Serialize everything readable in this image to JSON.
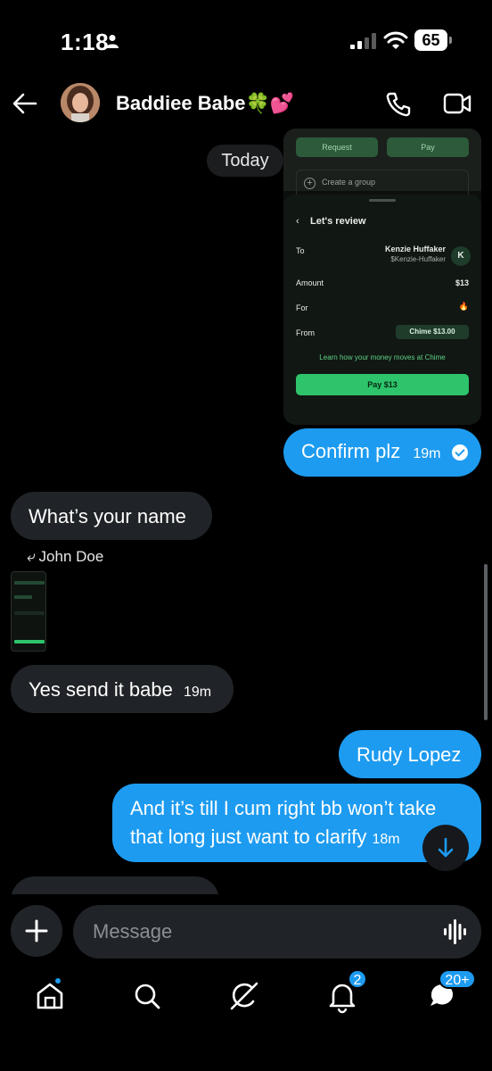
{
  "status_bar": {
    "time": "1:18",
    "battery": "65"
  },
  "header": {
    "contact_name": "Baddiee Babe🍀💕"
  },
  "conversation": {
    "date_separator": "Today",
    "embedded_screenshot": {
      "request_label": "Request",
      "pay_label": "Pay",
      "create_group": "Create a group",
      "title": "Let's review",
      "to_label": "To",
      "recipient_name": "Kenzie Huffaker",
      "recipient_tag": "$Kenzie-Huffaker",
      "recipient_initial": "K",
      "amount_label": "Amount",
      "amount_value": "$13",
      "for_label": "For",
      "for_value": "🔥",
      "from_label": "From",
      "from_value": "Chime  $13.00",
      "learn_link": "Learn how your money moves at Chime",
      "pay_button": "Pay $13"
    },
    "messages": [
      {
        "text": "Confirm plz",
        "time": "19m"
      },
      {
        "text": "What’s your name"
      },
      {
        "reply_to": "John Doe"
      },
      {
        "text": "Yes send it babe",
        "time": "19m"
      },
      {
        "text": "Rudy Lopez"
      },
      {
        "text": "And it’s till I cum right bb won’t take that long just want to clarify",
        "time": "18m"
      }
    ]
  },
  "composer": {
    "placeholder": "Message"
  },
  "tab_bar": {
    "notifications_badge": "2",
    "messages_badge": "20+"
  },
  "colors": {
    "accent": "#1d9bf0",
    "incoming_bubble": "#202327",
    "background": "#000000",
    "cash_green": "#2ec46b"
  }
}
